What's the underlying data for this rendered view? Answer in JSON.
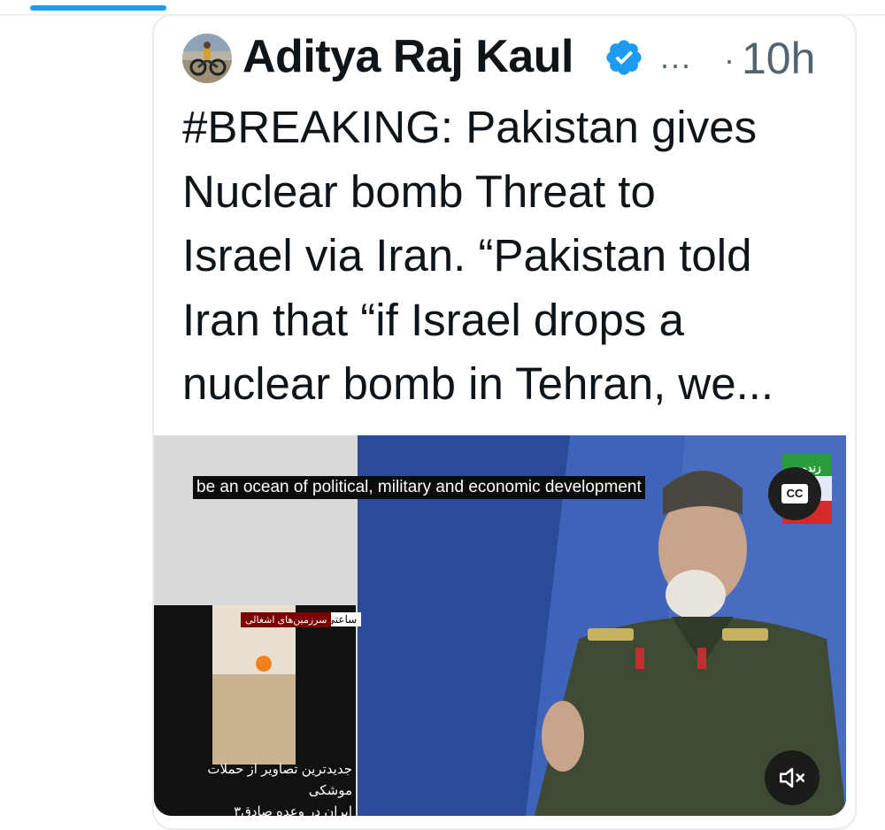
{
  "colors": {
    "accent": "#1d9bf0",
    "text_primary": "#0f1419",
    "text_secondary": "#536471"
  },
  "tweet": {
    "author_name": "Aditya Raj Kaul",
    "more_indicator": "...",
    "separator": "·",
    "time_ago": "10h",
    "text_lines": [
      "#BREAKING: Pakistan gives",
      "Nuclear bomb Threat to",
      "Israel via Iran. “Pakistan told",
      "Iran that “if Israel drops a",
      "nuclear bomb in Tehran, we..."
    ]
  },
  "video": {
    "subtitle": "be an ocean of political, military and economic development",
    "cc_label": "CC",
    "live_tag": "زنده",
    "inset_label_white": "ساعتی قبل",
    "inset_label_red": "سرزمین‌های اشغالی",
    "inset_caption_line1": "جدیدترین تصاویر از حملات موشکی",
    "inset_caption_line2": "ایران در وعده صادق۳",
    "icons": {
      "cc": "closed-captions-icon",
      "mute": "speaker-muted-icon"
    }
  }
}
